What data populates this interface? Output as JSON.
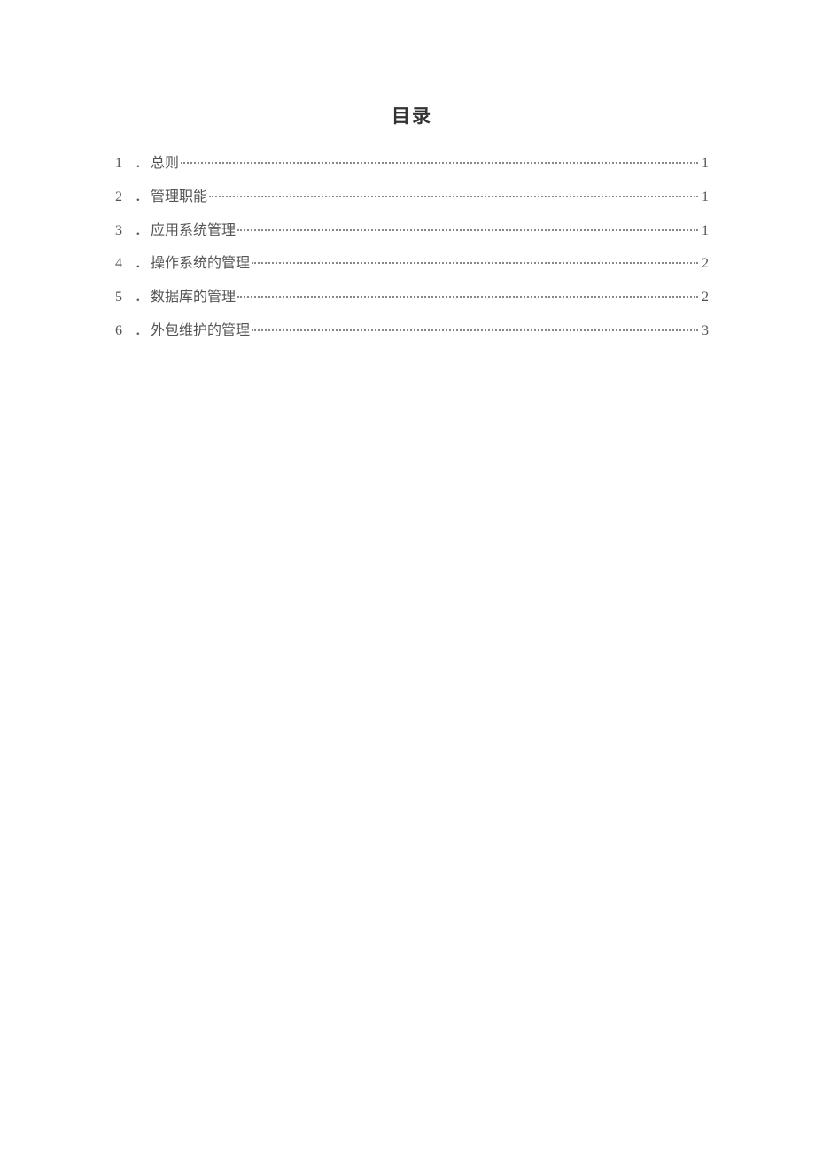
{
  "title": "目录",
  "toc": [
    {
      "num": "1",
      "sep": "．",
      "label": "总则",
      "page": "1"
    },
    {
      "num": "2",
      "sep": "．",
      "label": "管理职能",
      "page": "1"
    },
    {
      "num": "3",
      "sep": "．",
      "label": "应用系统管理",
      "page": "1"
    },
    {
      "num": "4",
      "sep": "．",
      "label": "操作系统的管理",
      "page": "2"
    },
    {
      "num": "5",
      "sep": "．",
      "label": "数据库的管理",
      "page": "2"
    },
    {
      "num": "6",
      "sep": "．",
      "label": "外包维护的管理",
      "page": "3"
    }
  ]
}
